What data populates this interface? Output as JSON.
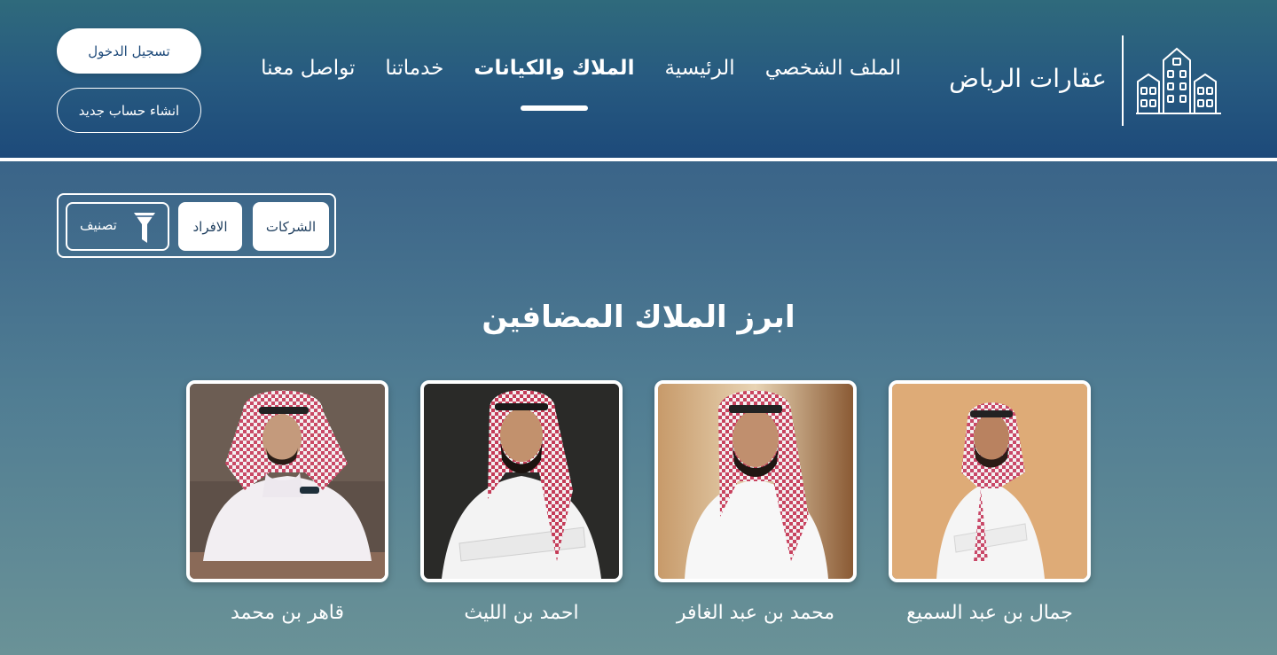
{
  "header": {
    "logo_text": "عقارات الرياض",
    "nav": [
      {
        "label": "الملف الشخصي",
        "active": false
      },
      {
        "label": "الرئيسية",
        "active": false
      },
      {
        "label": "الملاك والكيانات",
        "active": true
      },
      {
        "label": "خدماتنا",
        "active": false
      },
      {
        "label": "تواصل معنا",
        "active": false
      }
    ],
    "login_label": "تسجيل الدخول",
    "register_label": "انشاء حساب جديد"
  },
  "filters": {
    "companies_label": "الشركات",
    "individuals_label": "الافراد",
    "sort_label": "تصنيف"
  },
  "section": {
    "title": "ابرز الملاك المضافين"
  },
  "owners": [
    {
      "name": "جمال بن عبد السميع"
    },
    {
      "name": "محمد بن عبد الغافر"
    },
    {
      "name": "احمد بن الليث"
    },
    {
      "name": "قاهر بن محمد"
    }
  ],
  "colors": {
    "header_top": "#2f6a7c",
    "header_bottom": "#1d4a7a",
    "page_bottom": "#6a9297",
    "accent": "#ffffff"
  }
}
